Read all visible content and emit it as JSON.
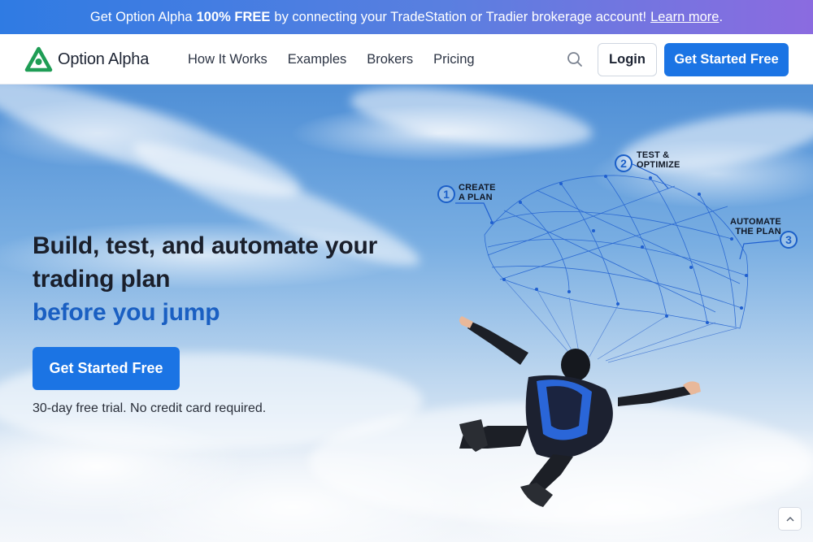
{
  "announcement": {
    "prefix": "Get Option Alpha",
    "highlight": "100% FREE",
    "suffix": "by connecting your TradeStation or Tradier brokerage account!",
    "link": "Learn more",
    "period": "."
  },
  "nav": {
    "brand": "Option Alpha",
    "links": [
      "How It Works",
      "Examples",
      "Brokers",
      "Pricing"
    ],
    "login": "Login",
    "cta": "Get Started Free",
    "search_icon": "search-icon"
  },
  "hero": {
    "title_line1": "Build, test, and automate your",
    "title_line2": "trading plan",
    "title_accent": "before you jump",
    "cta": "Get Started Free",
    "note": "30-day free trial. No credit card required."
  },
  "steps": [
    {
      "number": "1",
      "line1": "CREATE",
      "line2": "A PLAN"
    },
    {
      "number": "2",
      "line1": "TEST &",
      "line2": "OPTIMIZE"
    },
    {
      "number": "3",
      "line1": "AUTOMATE",
      "line2": "THE PLAN"
    }
  ],
  "colors": {
    "brand_blue": "#1b74e4",
    "accent_text": "#1a5fc2",
    "logo_green": "#1f9d55"
  }
}
